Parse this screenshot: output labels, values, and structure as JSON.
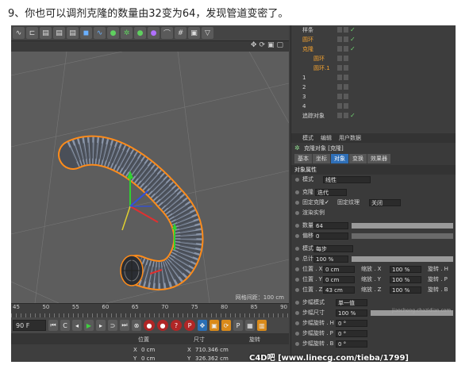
{
  "caption": "9、你也可以调剂克隆的数量由32变为64，发现管道变密了。",
  "toolbar": {
    "icons": [
      "spline-icon",
      "deform-icon",
      "clapper-icon",
      "clapper-icon",
      "clapper-icon",
      "cube-icon",
      "curve-icon",
      "sphere-icon",
      "gear-icon",
      "sphere-icon",
      "sphere-icon",
      "bend-icon",
      "grid-icon",
      "camera-icon",
      "light-icon"
    ]
  },
  "viewport": {
    "grid_spacing_label": "网格间距：100 cm"
  },
  "ruler": {
    "ticks": [
      "45",
      "50",
      "55",
      "60",
      "65",
      "70",
      "75",
      "80",
      "85",
      "90"
    ]
  },
  "transport": {
    "frame_value": "90 F"
  },
  "object_manager": {
    "items": [
      {
        "name": "样条",
        "color": "#d8d8d8",
        "indent": 14
      },
      {
        "name": "圆环",
        "color": "#f0a030",
        "indent": 14
      },
      {
        "name": "克隆",
        "color": "#f0a030",
        "indent": 14
      },
      {
        "name": "圆环",
        "color": "#f0a030",
        "indent": 28
      },
      {
        "name": "圆环.1",
        "color": "#f0a030",
        "indent": 28
      },
      {
        "name": "1",
        "color": "#d8d8d8",
        "indent": 14
      },
      {
        "name": "2",
        "color": "#d8d8d8",
        "indent": 14
      },
      {
        "name": "3",
        "color": "#d8d8d8",
        "indent": 14
      },
      {
        "name": "4",
        "color": "#d8d8d8",
        "indent": 14
      },
      {
        "name": "追踪对象",
        "color": "#d8d8d8",
        "indent": 14
      }
    ]
  },
  "attribute_manager": {
    "menu": [
      "模式",
      "编辑",
      "用户数据"
    ],
    "title": "克隆对象 [克隆]",
    "tabs": [
      {
        "label": "基本",
        "active": false
      },
      {
        "label": "坐标",
        "active": false
      },
      {
        "label": "对象",
        "active": true
      },
      {
        "label": "变换",
        "active": false
      },
      {
        "label": "效果器",
        "active": false
      }
    ],
    "section": "对象属性",
    "mode_label": "模式",
    "mode_value": "线性",
    "clone_label": "克隆",
    "clone_value": "迭代",
    "fixed_clone_label": "固定克隆",
    "fixed_clone_check": "✓",
    "fixed_texture_label": "固定纹理",
    "fixed_texture_value": "关闭",
    "render_instances_label": "渲染实例",
    "count_label": "数量",
    "count_value": "64",
    "offset_label": "偏移",
    "offset_value": "0",
    "linear_mode_label": "模式",
    "linear_mode_value": "每步",
    "total_label": "总计",
    "total_value": "100 %",
    "pos_x_label": "位置 . X",
    "pos_x_value": "0 cm",
    "pos_y_label": "位置 . Y",
    "pos_y_value": "0 cm",
    "pos_z_label": "位置 . Z",
    "pos_z_value": "43 cm",
    "scale_x_label": "缩放 . X",
    "scale_x_value": "100 %",
    "scale_y_label": "缩放 . Y",
    "scale_y_value": "100 %",
    "scale_z_label": "缩放 . Z",
    "scale_z_value": "100 %",
    "rot_h_label": "旋转 . H",
    "rot_p_label": "旋转 . P",
    "rot_b_label": "旋转 . B",
    "step_mode_label": "步幅模式",
    "step_mode_value": "单一值",
    "step_size_label": "步幅尺寸",
    "step_size_value": "100 %",
    "step_rot_h_label": "步幅旋转 . H",
    "step_rot_h_value": "0 °",
    "step_rot_p_label": "步幅旋转 . P",
    "step_rot_p_value": "0 °",
    "step_rot_b_label": "步幅旋转 . B",
    "step_rot_b_value": "0 °"
  },
  "coordinates": {
    "header_position": "位置",
    "header_size": "尺寸",
    "header_rotation": "旋转",
    "x_label": "X",
    "x_pos": "0 cm",
    "x_size": "710.346 cm",
    "y_label": "Y",
    "y_pos": "0 cm",
    "y_size": "326.362 cm"
  },
  "watermark": "C4D吧  [www.linecg.com/tieba/1799]",
  "credit": "jiaocheng.chazidian.com"
}
